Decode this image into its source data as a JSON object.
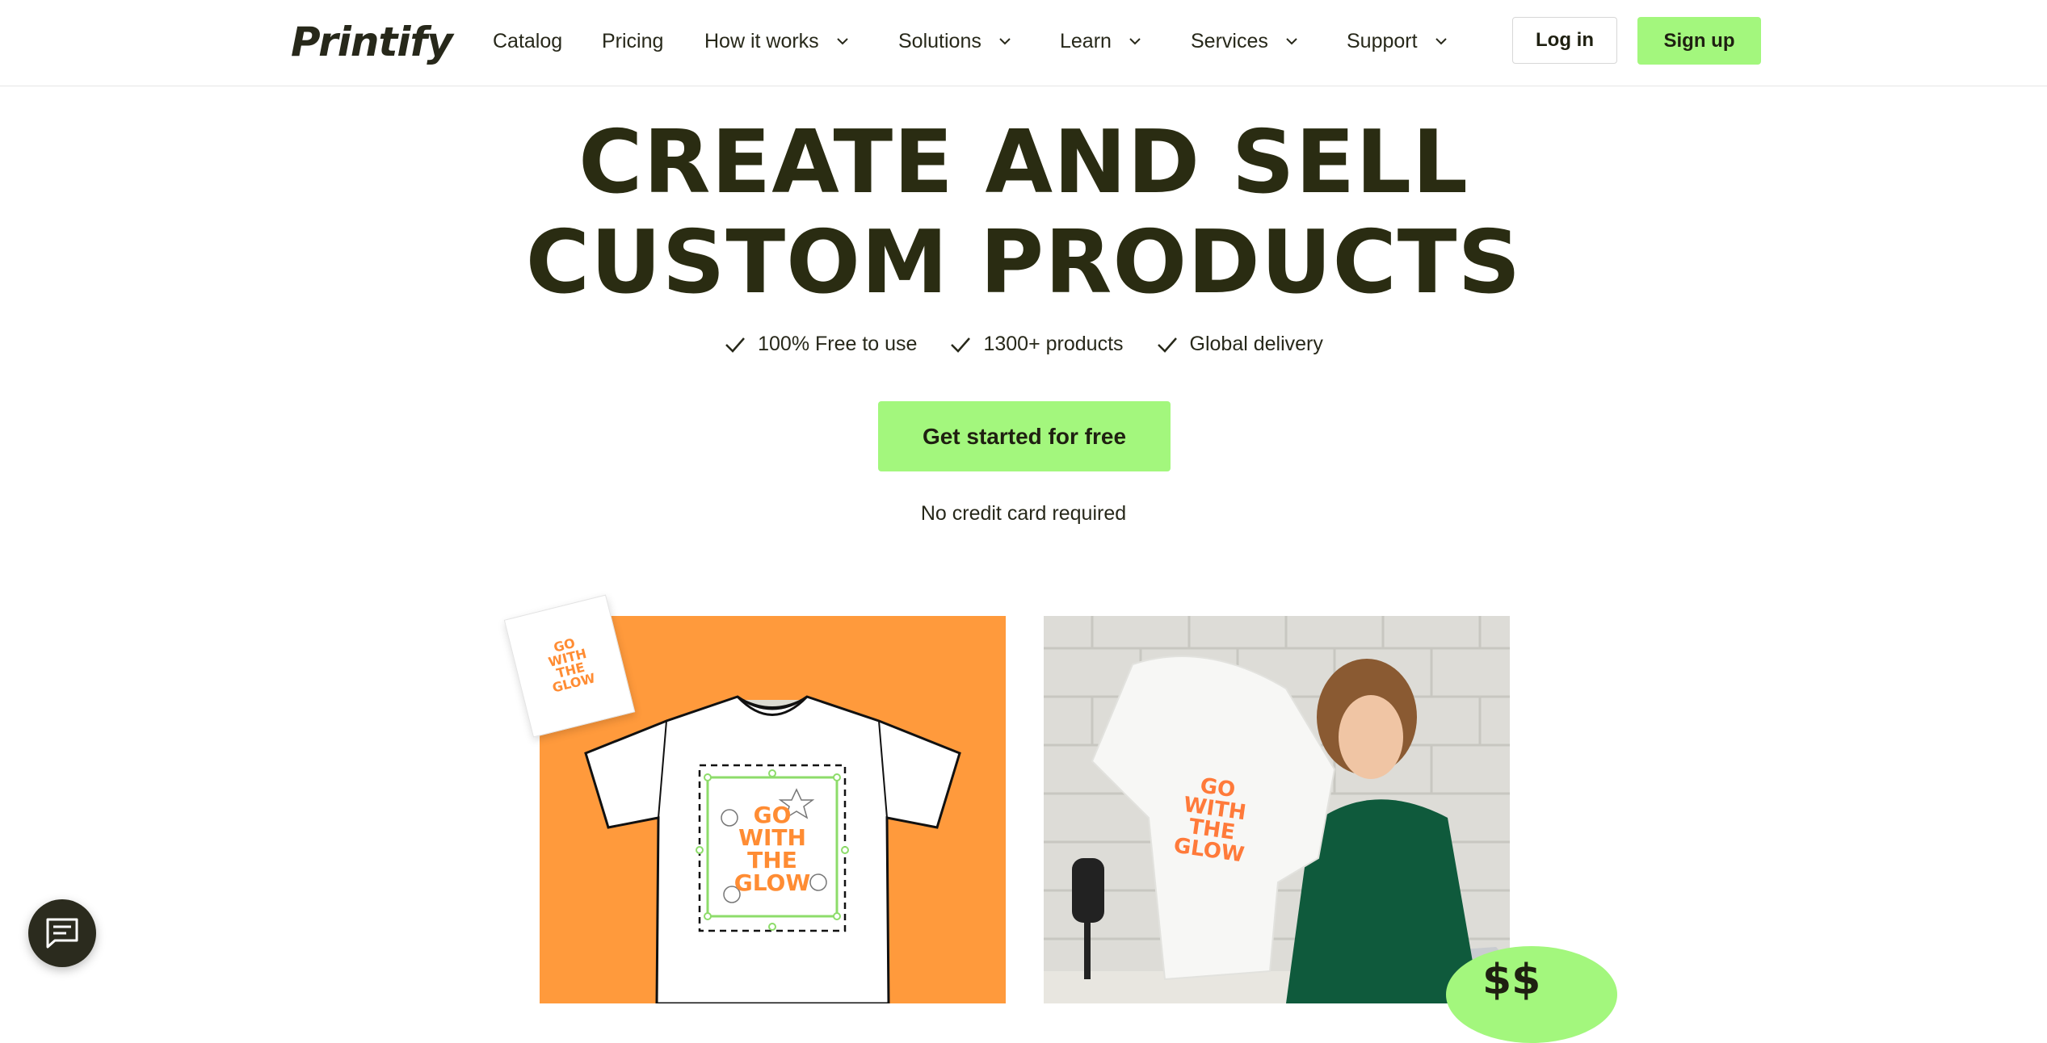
{
  "header": {
    "logo": "Printify",
    "nav": [
      {
        "label": "Catalog",
        "dropdown": false
      },
      {
        "label": "Pricing",
        "dropdown": false
      },
      {
        "label": "How it works",
        "dropdown": true
      },
      {
        "label": "Solutions",
        "dropdown": true
      },
      {
        "label": "Learn",
        "dropdown": true
      },
      {
        "label": "Services",
        "dropdown": true
      },
      {
        "label": "Support",
        "dropdown": true
      }
    ],
    "login_label": "Log in",
    "signup_label": "Sign up"
  },
  "hero": {
    "title_line1": "CREATE AND SELL",
    "title_line2": "CUSTOM PRODUCTS",
    "features": [
      "100% Free to use",
      "1300+ products",
      "Global delivery"
    ],
    "cta_label": "Get started for free",
    "note": "No credit card required"
  },
  "images": {
    "design_text_lines": [
      "GO",
      "WITH",
      "THE",
      "GLOW"
    ],
    "price_sticker": "$$"
  },
  "colors": {
    "accent_green": "#a3f77d",
    "hero_text": "#2a2c12",
    "orange": "#ff9a3c",
    "design_orange": "#ff8c33"
  },
  "icons": {
    "nav_dropdown": "chevron-down-icon",
    "feature": "check-icon",
    "chat": "chat-icon"
  }
}
